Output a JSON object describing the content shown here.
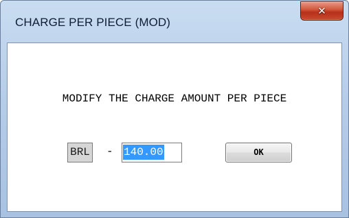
{
  "window": {
    "title": "CHARGE PER PIECE (MOD)",
    "close_icon": "close-icon",
    "close_glyph": "✕"
  },
  "dialog": {
    "message": "MODIFY THE CHARGE AMOUNT PER PIECE",
    "currency": "BRL",
    "separator": "-",
    "amount": "140.00",
    "ok_label": "OK"
  },
  "colors": {
    "title_bar": "#b6cde9",
    "close_button": "#c94b2f",
    "selection": "#3399ff",
    "currency_box": "#d6d6d6"
  }
}
